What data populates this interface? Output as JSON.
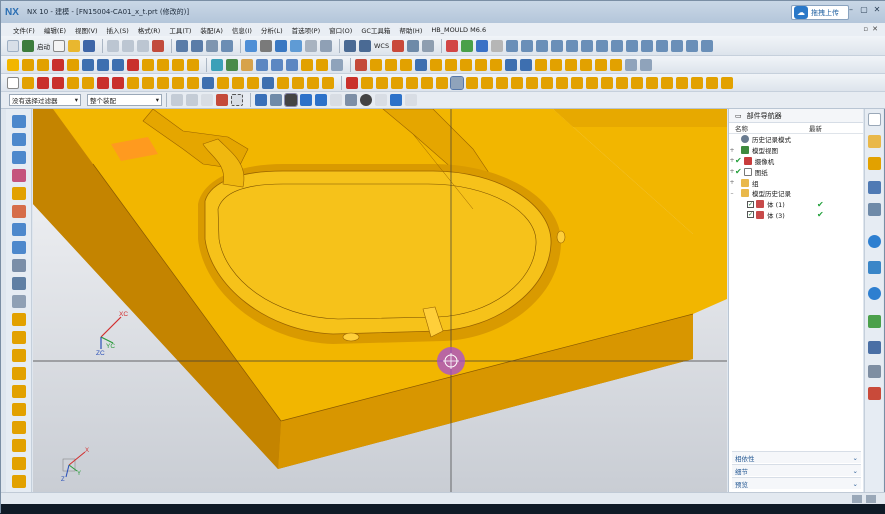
{
  "window": {
    "logo": "NX",
    "title": "NX 10 - 建模 - [FN15004-CA01_x_t.prt (修改的)]",
    "upload_label": "拖拽上传",
    "controls": [
      "–",
      "▢",
      "✕"
    ]
  },
  "menubar": {
    "items": [
      "文件(F)",
      "编辑(E)",
      "视图(V)",
      "插入(S)",
      "格式(R)",
      "工具(T)",
      "装配(A)",
      "信息(I)",
      "分析(L)",
      "首选项(P)",
      "窗口(O)",
      "GC工具箱",
      "帮助(H)",
      "HB_MOULD M6.6"
    ]
  },
  "toolbar": {
    "start_label": "启动",
    "wcs_label": "WCS"
  },
  "selection_bar": {
    "filter_value": "没有选择过滤器",
    "scope_value": "整个装配"
  },
  "viewport": {
    "triad_top": {
      "x": "XC",
      "y": "YC",
      "z": "ZC"
    },
    "triad_bottom": {
      "x": "X",
      "y": "Y",
      "z": "Z"
    },
    "colors": {
      "part": "#f2b600",
      "side_dark": "#b97a00",
      "side_mid": "#d89600",
      "crosshair": "#3b3b3b",
      "cursor": "#a64bd8"
    }
  },
  "navigator": {
    "title": "部件导航器",
    "col_name": "名称",
    "col_latest": "最新",
    "nodes": [
      {
        "label": "历史记录模式",
        "icon": "clock-icon"
      },
      {
        "label": "模型视图",
        "icon": "model-views-icon"
      },
      {
        "label": "摄像机",
        "icon": "camera-icon"
      },
      {
        "label": "图纸",
        "icon": "drawing-icon"
      },
      {
        "label": "组",
        "icon": "folder-icon"
      },
      {
        "label": "模型历史记录",
        "icon": "folder-icon"
      },
      {
        "label": "体 (1)",
        "icon": "body-icon"
      },
      {
        "label": "体 (3)",
        "icon": "body-icon"
      }
    ],
    "sections": [
      "相依性",
      "细节",
      "预览"
    ]
  }
}
